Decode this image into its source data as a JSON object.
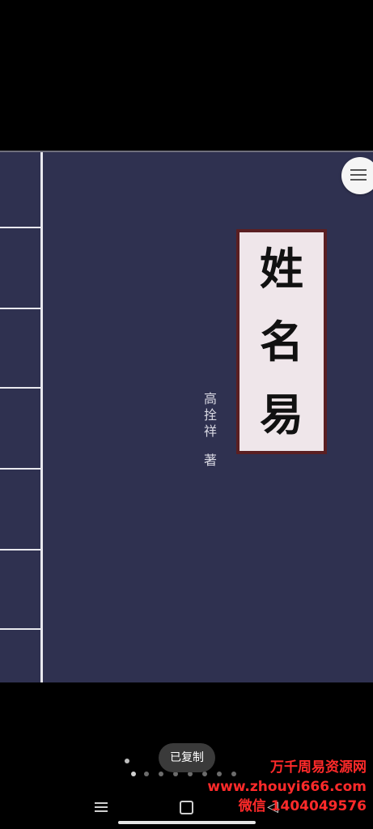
{
  "book": {
    "title_chars": [
      "姓",
      "名",
      "易"
    ],
    "author_chars": [
      "高",
      "拴",
      "祥",
      "著"
    ]
  },
  "toast": {
    "text": "已复制"
  },
  "watermark": {
    "line1": "万千周易资源网",
    "line2": "www.zhouyi666.com",
    "line3": "微信 1404049576"
  },
  "nav": {
    "back_glyph": "◁"
  },
  "colors": {
    "cover": "#2f3150",
    "spine_line": "#e8e8ee",
    "title_border": "#5a1f22",
    "title_bg": "#efe6ea",
    "watermark": "#ff2a2a"
  }
}
